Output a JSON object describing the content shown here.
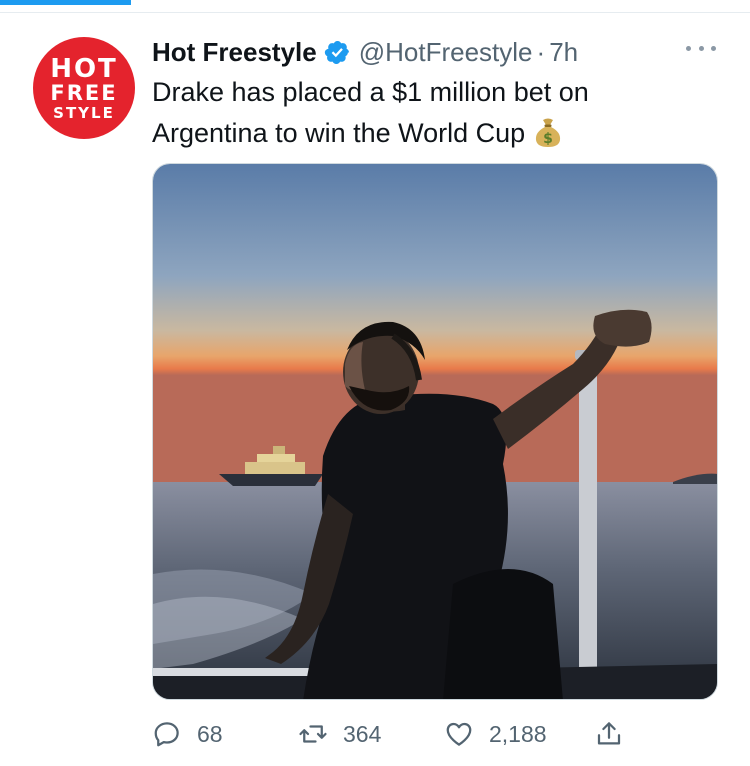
{
  "nav": {
    "active_tab_indicator_color": "#1d9bf0"
  },
  "tweet": {
    "avatar": {
      "lines": [
        "HOT",
        "FREE",
        "STYLE"
      ],
      "background": "#e4232d"
    },
    "display_name": "Hot Freestyle",
    "verified": true,
    "handle": "@HotFreestyle",
    "separator": "·",
    "time": "7h",
    "text_lines": [
      "Drake has placed a $1 million bet on",
      "Argentina to win the World Cup"
    ],
    "emoji": "money-bag-icon",
    "media": {
      "kind": "photo",
      "alt_icon": "man-on-boat-at-sunset"
    },
    "actions": {
      "replies": "68",
      "retweets": "364",
      "likes": "2,188"
    }
  },
  "colors": {
    "text": "#0f1419",
    "secondary": "#536471",
    "accent": "#1d9bf0"
  }
}
